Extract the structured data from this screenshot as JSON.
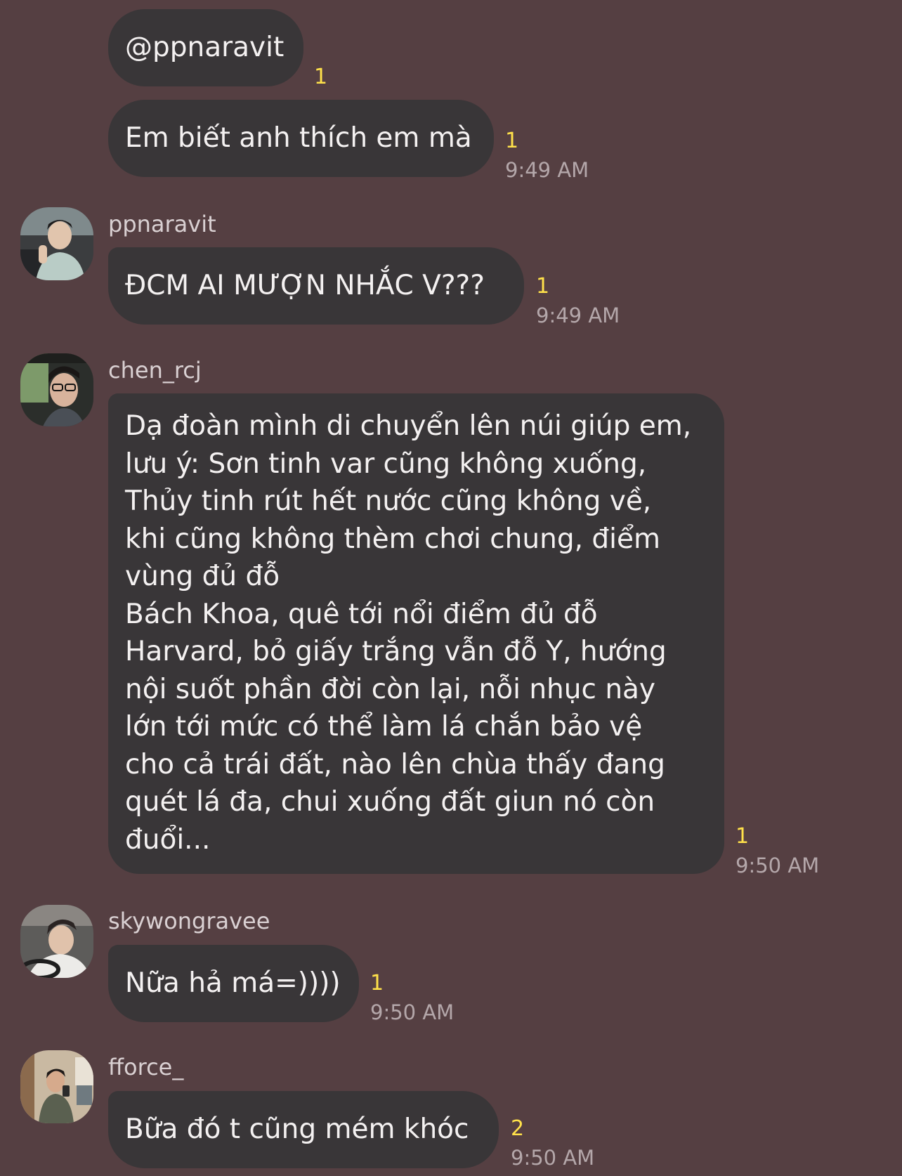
{
  "colors": {
    "background": "#553f42",
    "bubble": "#393638",
    "bubble_text": "#f4f1f1",
    "read_count": "#ffe14a",
    "timestamp": "#b4a7aa",
    "sender_name": "#d9d0d2"
  },
  "messages": [
    {
      "text": "@ppnaravit",
      "read_count": "1"
    },
    {
      "text": "Em biết anh thích em mà",
      "read_count": "1",
      "time": "9:49 AM"
    },
    {
      "sender": "ppnaravit",
      "text": "ĐCM AI MƯỢN NHẮC V???",
      "read_count": "1",
      "time": "9:49 AM"
    },
    {
      "sender": "chen_rcj",
      "text": "Dạ đoàn mình di chuyển lên núi giúp em,\nlưu ý: Sơn tinh var cũng không xuống,\nThủy tinh rút hết nước cũng không về,\nkhi cũng không thèm chơi chung, điểm\nvùng đủ đỗ\nBách Khoa, quê tới nổi điểm đủ đỗ\nHarvard, bỏ giấy trắng vẫn đỗ Y, hướng\nnội suốt phần đời còn lại, nỗi nhục này\nlớn tới mức có thể làm lá chắn bảo vệ\ncho cả trái đất, nào lên chùa thấy đang\nquét lá đa, chui xuống đất giun nó còn\nđuổi...",
      "read_count": "1",
      "time": "9:50 AM"
    },
    {
      "sender": "skywongravee",
      "text": "Nữa hả má=))))",
      "read_count": "1",
      "time": "9:50 AM"
    },
    {
      "sender": "fforce_",
      "text": "Bữa đó t cũng mém khóc",
      "read_count": "2",
      "time": "9:50 AM"
    }
  ]
}
